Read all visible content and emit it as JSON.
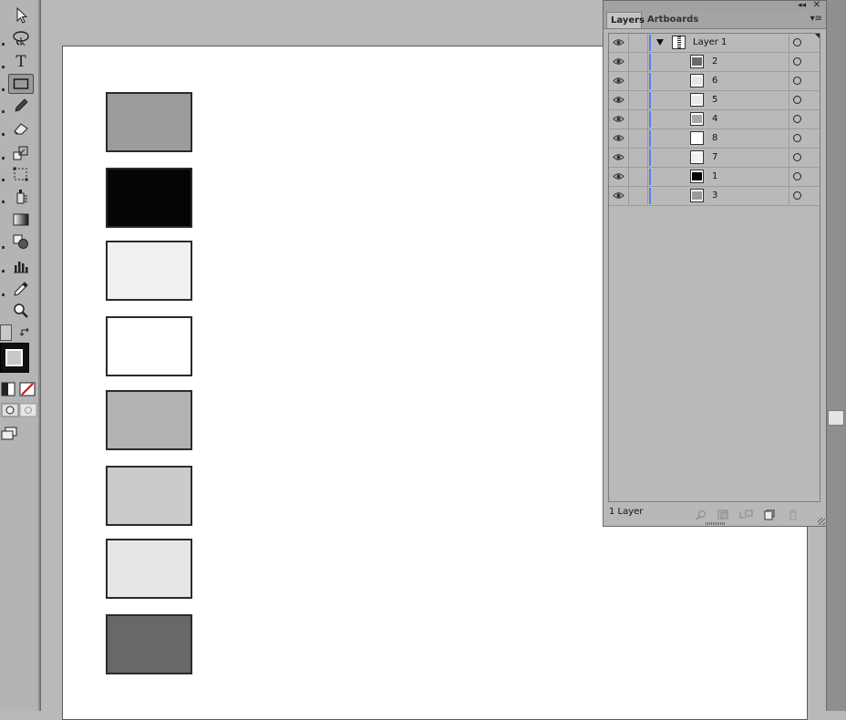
{
  "tools": {
    "items": [
      {
        "name": "selection-tool",
        "selected": false
      },
      {
        "name": "lasso-tool",
        "selected": false
      },
      {
        "name": "type-tool",
        "selected": false,
        "glyph": "T"
      },
      {
        "name": "rectangle-tool",
        "selected": true
      },
      {
        "name": "pencil-tool",
        "selected": false
      },
      {
        "name": "eraser-tool",
        "selected": false
      },
      {
        "name": "scale-tool",
        "selected": false
      },
      {
        "name": "free-transform-tool",
        "selected": false
      },
      {
        "name": "symbol-sprayer-tool",
        "selected": false
      },
      {
        "name": "gradient-tool",
        "selected": false
      },
      {
        "name": "shape-builder-tool",
        "selected": false
      },
      {
        "name": "graph-tool",
        "selected": false
      },
      {
        "name": "eyedropper-tool",
        "selected": false
      },
      {
        "name": "zoom-tool",
        "selected": false
      }
    ]
  },
  "artboard": {
    "swatches": [
      {
        "color": "#9c9c9c"
      },
      {
        "color": "#050505"
      },
      {
        "color": "#f0f0f0"
      },
      {
        "color": "#ffffff"
      },
      {
        "color": "#b2b2b2"
      },
      {
        "color": "#cbcbcb"
      },
      {
        "color": "#e6e6e6"
      },
      {
        "color": "#686868"
      }
    ]
  },
  "layers_panel": {
    "tabs": {
      "layers": "Layers",
      "artboards": "Artboards"
    },
    "collapse_glyph": "◂◂",
    "close_glyph": "✕",
    "menu_glyph": "▾≡",
    "parent_layer": {
      "label": "Layer 1"
    },
    "sublayers": [
      {
        "label": "2",
        "color": "#6a6a6a"
      },
      {
        "label": "6",
        "color": "#e6e6e6"
      },
      {
        "label": "5",
        "color": "#e9e9e9"
      },
      {
        "label": "4",
        "color": "#a8a8a8"
      },
      {
        "label": "8",
        "color": "#ffffff"
      },
      {
        "label": "7",
        "color": "#f2f2f2"
      },
      {
        "label": "1",
        "color": "#000000"
      },
      {
        "label": "3",
        "color": "#9a9a9a"
      }
    ],
    "footer": {
      "layer_count": "1 Layer"
    }
  },
  "colors": {
    "layer_color_bar": "#5a7cf0",
    "stroke_swatch": "#111111"
  }
}
